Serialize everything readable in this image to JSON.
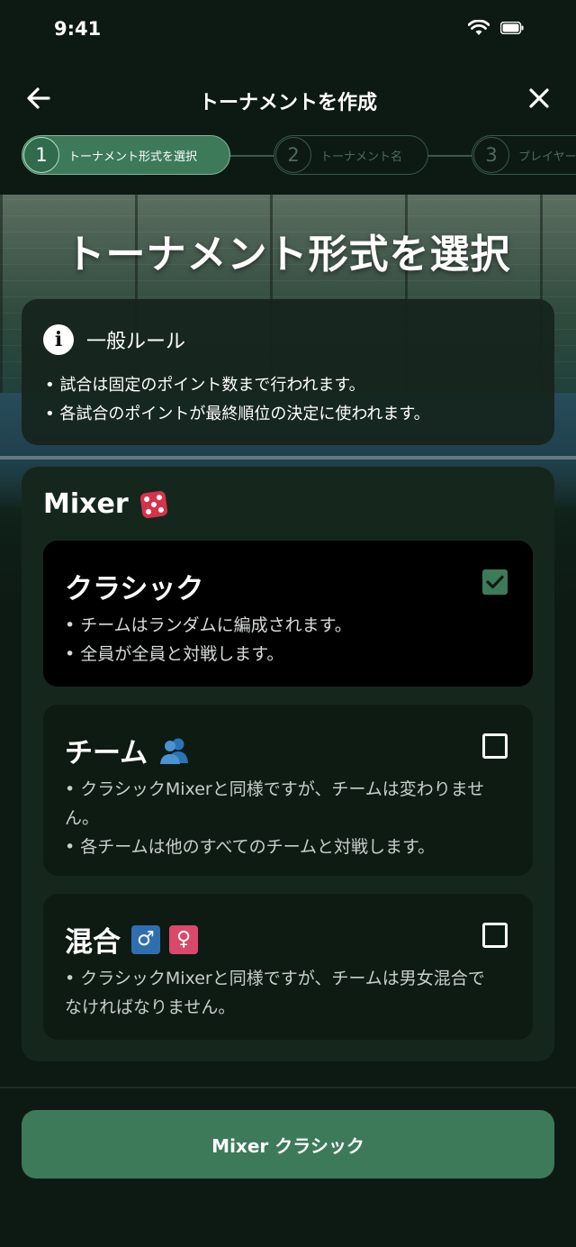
{
  "status_bar": {
    "time": "9:41"
  },
  "nav": {
    "title": "トーナメントを作成"
  },
  "stepper": [
    {
      "number": "1",
      "label": "トーナメント形式を選択",
      "state": "active"
    },
    {
      "number": "2",
      "label": "トーナメント名",
      "state": "inactive"
    },
    {
      "number": "3",
      "label": "プレイヤー",
      "state": "inactive"
    }
  ],
  "hero": {
    "title": "トーナメント形式を選択"
  },
  "rules": {
    "title": "一般ルール",
    "items": [
      "• 試合は固定のポイント数まで行われます。",
      "• 各試合のポイントが最終順位の決定に使われます。"
    ]
  },
  "section": {
    "title": "Mixer",
    "icon": "dice-icon",
    "options": [
      {
        "title": "クラシック",
        "selected": true,
        "desc": [
          "• チームはランダムに編成されます。",
          "• 全員が全員と対戦します。"
        ]
      },
      {
        "title": "チーム",
        "icon": "people-icon",
        "selected": false,
        "desc": [
          "• クラシックMixerと同様ですが、チームは変わりません。",
          "• 各チームは他のすべてのチームと対戦します。"
        ]
      },
      {
        "title": "混合",
        "icons": [
          "male-sign-icon",
          "female-sign-icon"
        ],
        "male_symbol": "♂",
        "female_symbol": "♀",
        "selected": false,
        "desc": [
          "• クラシックMixerと同様ですが、チームは男女混合でなければなりません。"
        ]
      }
    ]
  },
  "cta": {
    "label": "Mixer クラシック"
  },
  "colors": {
    "accent": "#3c7a5a",
    "background": "#0d1a13",
    "card": "#15271d",
    "dice": "#d6334a",
    "male": "#2f6fb0",
    "female": "#d94a6a"
  }
}
